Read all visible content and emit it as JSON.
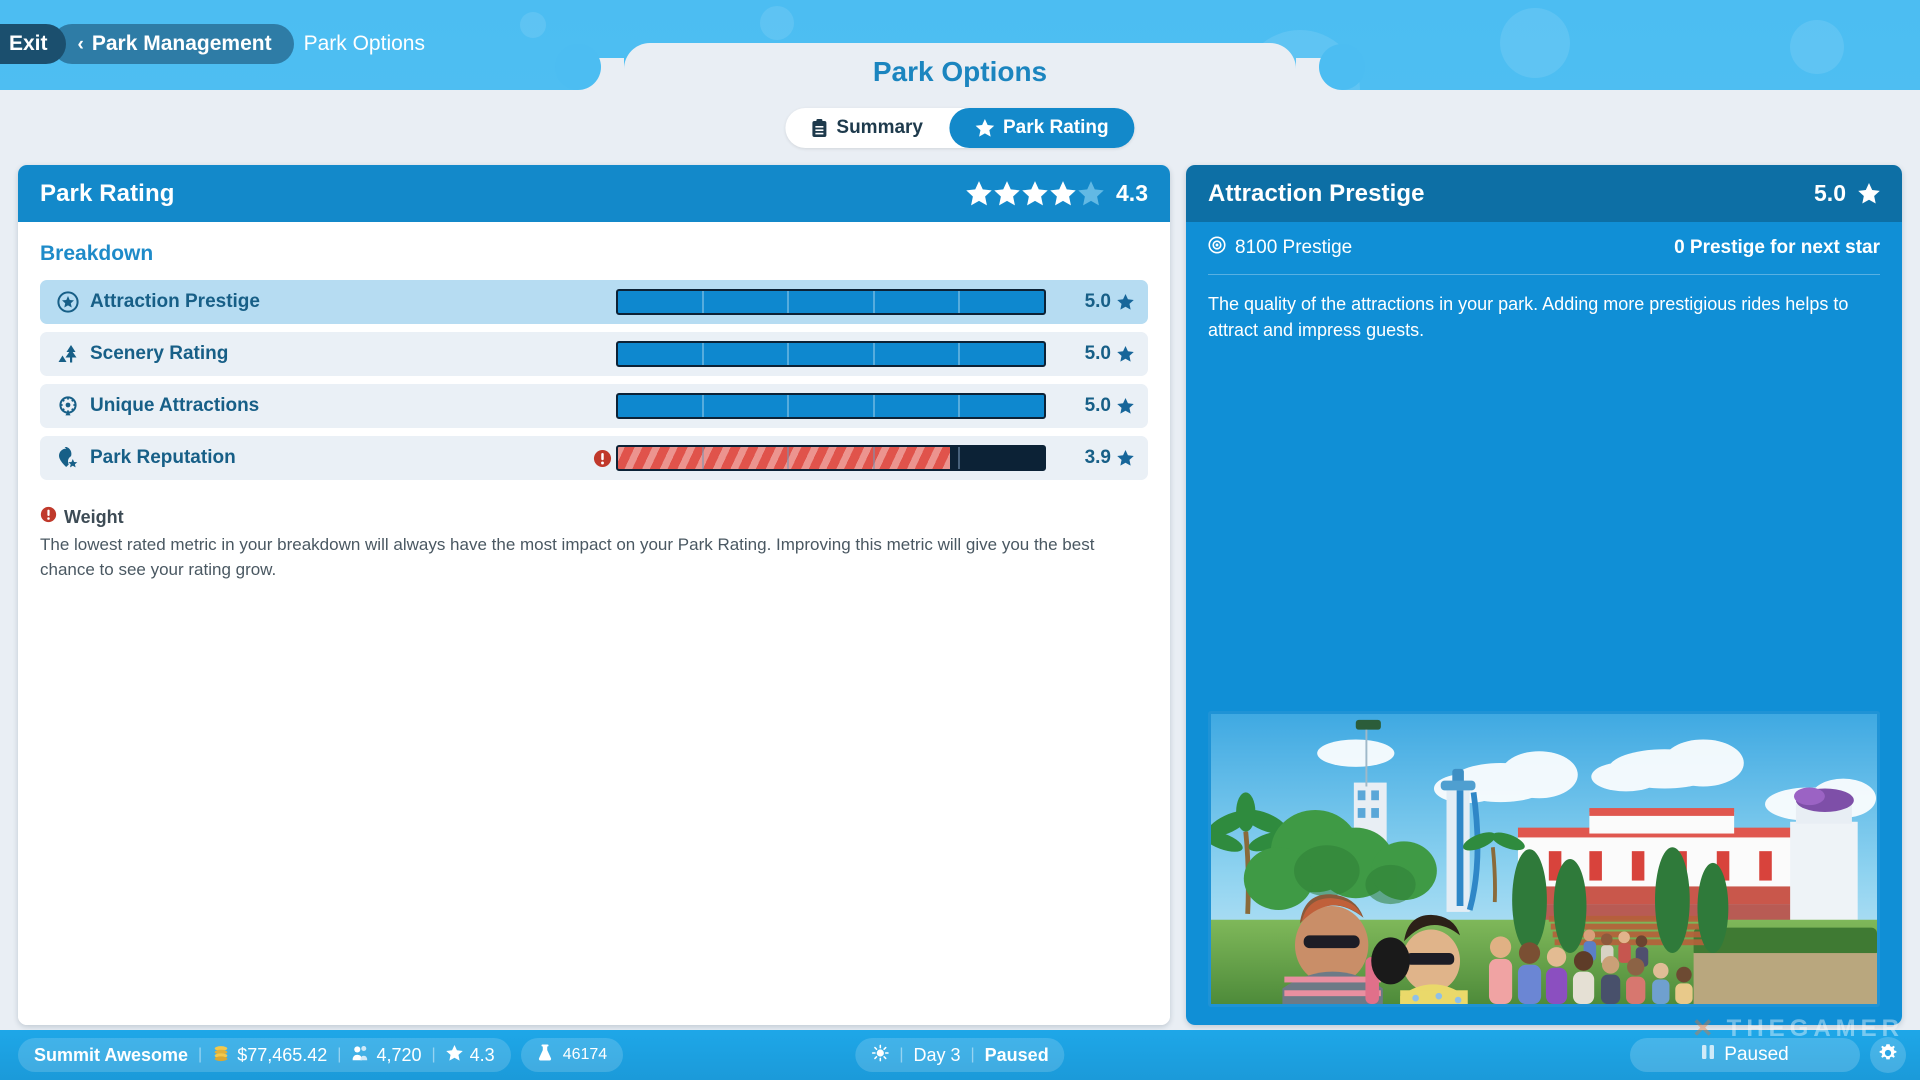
{
  "breadcrumb": {
    "exit_label": "Exit",
    "back_chevron": "‹",
    "parent_label": "Park Management",
    "current_label": "Park Options"
  },
  "header": {
    "title": "Park Options"
  },
  "tabs": [
    {
      "label": "Summary",
      "icon": "clipboard-icon",
      "active": false
    },
    {
      "label": "Park Rating",
      "icon": "star-icon",
      "active": true
    }
  ],
  "park_rating_panel": {
    "title": "Park Rating",
    "score": "4.3",
    "stars_filled": 4,
    "stars_total": 5,
    "breakdown_title": "Breakdown",
    "rows": [
      {
        "label": "Attraction Prestige",
        "icon": "star-circle-icon",
        "score": "5.0",
        "fill_percent": 100,
        "state": "good",
        "selected": true,
        "warning": false
      },
      {
        "label": "Scenery Rating",
        "icon": "tree-icon",
        "score": "5.0",
        "fill_percent": 100,
        "state": "good",
        "selected": false,
        "warning": false
      },
      {
        "label": "Unique Attractions",
        "icon": "ferris-wheel-icon",
        "score": "5.0",
        "fill_percent": 100,
        "state": "good",
        "selected": false,
        "warning": false
      },
      {
        "label": "Park Reputation",
        "icon": "pin-star-icon",
        "score": "3.9",
        "fill_percent": 78,
        "state": "danger",
        "selected": false,
        "warning": true
      }
    ],
    "weight": {
      "title": "Weight",
      "icon": "warning-icon",
      "body": "The lowest rated metric in your breakdown will always have the most impact on your Park Rating. Improving this metric will give you the best chance to see your rating grow."
    }
  },
  "detail_panel": {
    "title": "Attraction Prestige",
    "score": "5.0",
    "stat_icon": "prestige-icon",
    "stat_value": "8100 Prestige",
    "next_star_text": "0 Prestige for next star",
    "description": "The quality of the attractions in your park. Adding more prestigious rides helps to attract and impress guests.",
    "photo_alt": "park-guests-photo"
  },
  "hud": {
    "park_name": "Summit Awesome",
    "money": "$77,465.42",
    "guests": "4,720",
    "rating": "4.3",
    "science": "46174",
    "day": "Day 3",
    "status": "Paused",
    "pause_button_label": "Paused",
    "icons": {
      "money": "coins-icon",
      "guests": "guests-icon",
      "rating": "star-icon",
      "science": "flask-icon",
      "weather": "sun-icon",
      "pause": "pause-icon",
      "settings": "gear-icon"
    }
  },
  "watermark": {
    "text": "THEGAMER"
  },
  "colors": {
    "sky": "#4cbdf2",
    "sheet": "#e9eef4",
    "accent": "#1389ca",
    "panel_header_dark": "#0d6fa5",
    "panel_body_blue": "#108fd6",
    "row_bg": "#eaf0f6",
    "row_selected": "#b6dcf2",
    "bar_good": "#0e88cf",
    "bar_danger": "#e0534b",
    "bar_track": "#0c2236",
    "text_blue": "#175f87",
    "warning_red": "#c0392b"
  }
}
